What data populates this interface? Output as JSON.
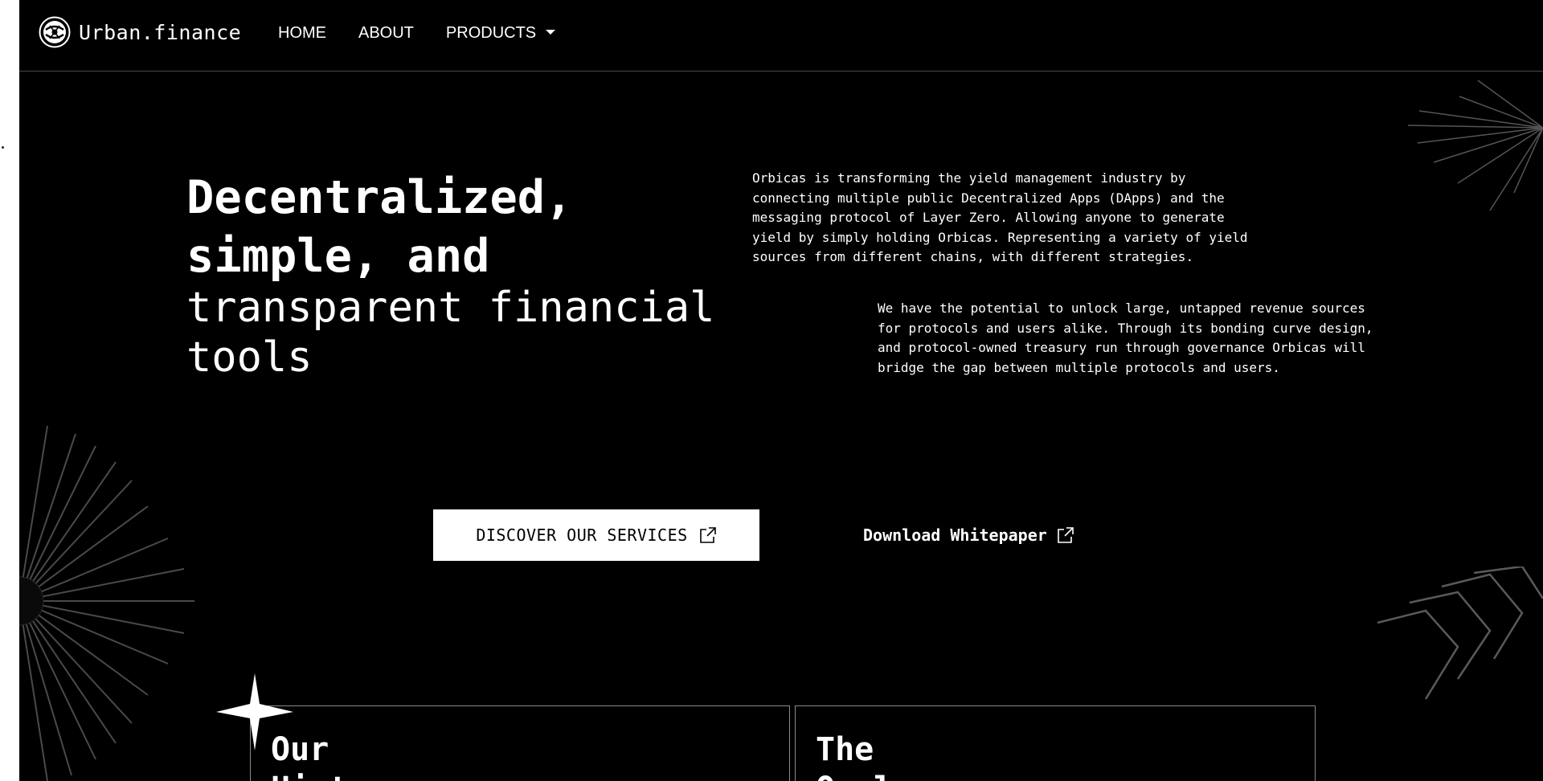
{
  "nav": {
    "brand": "Urban.finance",
    "items": [
      {
        "label": "HOME"
      },
      {
        "label": "ABOUT"
      },
      {
        "label": "PRODUCTS"
      }
    ]
  },
  "hero": {
    "headline_bold": "Decentralized, simple, and",
    "headline_light": "transparent financial tools",
    "paragraph_1": "Orbicas is transforming the yield management industry by connecting multiple public Decentralized Apps (DApps) and the messaging protocol of Layer Zero. Allowing anyone to generate yield by simply holding Orbicas. Representing a variety of yield sources from different chains, with different strategies.",
    "paragraph_2": "We have the potential to unlock large, untapped revenue sources for protocols and users alike. Through its bonding curve design, and protocol-owned treasury run through governance Orbicas will bridge the gap between multiple protocols and users."
  },
  "cta": {
    "primary_label": "DISCOVER OUR SERVICES",
    "secondary_label": "Download Whitepaper"
  },
  "cards": [
    {
      "title": "Our",
      "subtitle": "Hist"
    },
    {
      "title": "The",
      "subtitle": "Opal"
    }
  ],
  "icons": {
    "logo": "globe-logo-icon",
    "dropdown": "caret-down-icon",
    "external": "external-link-icon",
    "star": "sparkle-star-icon"
  },
  "colors": {
    "background": "#000000",
    "text": "#ffffff",
    "button_bg": "#ffffff",
    "button_text": "#000000",
    "decor_lines": "#4a4a4a",
    "divider": "#4a4a4a"
  }
}
